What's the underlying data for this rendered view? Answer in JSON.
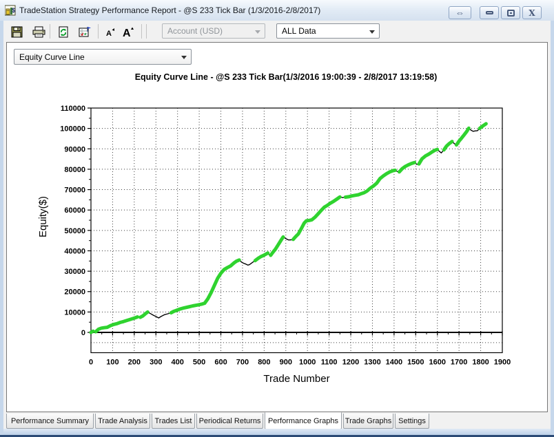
{
  "window": {
    "title": "TradeStation Strategy Performance Report - @S 233 Tick Bar (1/3/2016-2/8/2017)",
    "buttons": {
      "dock": "⇔",
      "close": "X"
    }
  },
  "toolbar": {
    "icons": [
      "save-icon",
      "print-icon",
      "refresh-icon",
      "format-report-icon",
      "font-decrease-icon",
      "font-increase-icon"
    ],
    "account_combo": {
      "value": "Account (USD)",
      "disabled": true
    },
    "data_combo": {
      "value": "ALL Data",
      "disabled": false
    }
  },
  "report": {
    "graph_type_combo": {
      "value": "Equity Curve Line"
    }
  },
  "tabs": {
    "active": "Performance Graphs",
    "items": [
      {
        "label": "Performance Summary"
      },
      {
        "label": "Trade Analysis"
      },
      {
        "label": "Trades List"
      },
      {
        "label": "Periodical Returns"
      },
      {
        "label": "Performance Graphs"
      },
      {
        "label": "Trade Graphs"
      },
      {
        "label": "Settings"
      }
    ]
  },
  "chart_data": {
    "type": "line",
    "title": "Equity Curve Line - @S 233 Tick Bar(1/3/2016 19:00:39 - 2/8/2017 13:19:58)",
    "xlabel": "Trade Number",
    "ylabel": "Equity($)",
    "xlim": [
      0,
      1900
    ],
    "ylim": [
      -10000,
      110000
    ],
    "x_tick_step": 100,
    "y_tick_step": 10000,
    "grid": "dotted",
    "legend": "none",
    "colors": {
      "new_high": "#2fd32f",
      "drawdown": "#000000"
    },
    "coloring_rule": "segment drawn green when equity makes a new running high, black during drawdowns",
    "series": [
      {
        "name": "Equity",
        "points": [
          [
            0,
            0
          ],
          [
            10,
            600
          ],
          [
            22,
            300
          ],
          [
            35,
            1600
          ],
          [
            48,
            2100
          ],
          [
            60,
            2300
          ],
          [
            75,
            2500
          ],
          [
            90,
            3300
          ],
          [
            105,
            3900
          ],
          [
            120,
            4300
          ],
          [
            135,
            4900
          ],
          [
            150,
            5300
          ],
          [
            165,
            5800
          ],
          [
            180,
            6300
          ],
          [
            200,
            7000
          ],
          [
            215,
            7600
          ],
          [
            228,
            7400
          ],
          [
            240,
            8100
          ],
          [
            252,
            9200
          ],
          [
            262,
            10000
          ],
          [
            275,
            9200
          ],
          [
            290,
            8300
          ],
          [
            300,
            7800
          ],
          [
            313,
            7100
          ],
          [
            325,
            7900
          ],
          [
            340,
            8700
          ],
          [
            355,
            9100
          ],
          [
            370,
            9600
          ],
          [
            382,
            10300
          ],
          [
            395,
            10800
          ],
          [
            410,
            11400
          ],
          [
            430,
            12000
          ],
          [
            450,
            12500
          ],
          [
            470,
            13000
          ],
          [
            490,
            13400
          ],
          [
            510,
            13800
          ],
          [
            525,
            14300
          ],
          [
            540,
            16500
          ],
          [
            555,
            19500
          ],
          [
            570,
            23000
          ],
          [
            585,
            26500
          ],
          [
            600,
            29000
          ],
          [
            615,
            30800
          ],
          [
            630,
            31800
          ],
          [
            645,
            32600
          ],
          [
            660,
            34000
          ],
          [
            672,
            34900
          ],
          [
            685,
            35500
          ],
          [
            695,
            34500
          ],
          [
            705,
            33900
          ],
          [
            715,
            33500
          ],
          [
            725,
            33000
          ],
          [
            732,
            33200
          ],
          [
            745,
            34200
          ],
          [
            758,
            35200
          ],
          [
            772,
            36300
          ],
          [
            785,
            37200
          ],
          [
            800,
            37900
          ],
          [
            817,
            38900
          ],
          [
            823,
            38100
          ],
          [
            830,
            37800
          ],
          [
            840,
            39200
          ],
          [
            852,
            40800
          ],
          [
            865,
            43000
          ],
          [
            878,
            45200
          ],
          [
            888,
            46800
          ],
          [
            900,
            46000
          ],
          [
            913,
            45300
          ],
          [
            925,
            45400
          ],
          [
            934,
            45600
          ],
          [
            945,
            46900
          ],
          [
            958,
            48300
          ],
          [
            972,
            51000
          ],
          [
            985,
            53600
          ],
          [
            995,
            54700
          ],
          [
            1008,
            54900
          ],
          [
            1020,
            55200
          ],
          [
            1035,
            56500
          ],
          [
            1050,
            58200
          ],
          [
            1065,
            60000
          ],
          [
            1078,
            61400
          ],
          [
            1092,
            62300
          ],
          [
            1105,
            63300
          ],
          [
            1120,
            64200
          ],
          [
            1135,
            65300
          ],
          [
            1150,
            66400
          ],
          [
            1162,
            66100
          ],
          [
            1175,
            66300
          ],
          [
            1190,
            66500
          ],
          [
            1205,
            66900
          ],
          [
            1220,
            67200
          ],
          [
            1235,
            67500
          ],
          [
            1250,
            68100
          ],
          [
            1262,
            68500
          ],
          [
            1275,
            69300
          ],
          [
            1290,
            70700
          ],
          [
            1305,
            71800
          ],
          [
            1320,
            73200
          ],
          [
            1335,
            75400
          ],
          [
            1350,
            76700
          ],
          [
            1365,
            77800
          ],
          [
            1380,
            78700
          ],
          [
            1395,
            79300
          ],
          [
            1405,
            79500
          ],
          [
            1415,
            78900
          ],
          [
            1424,
            78700
          ],
          [
            1438,
            80300
          ],
          [
            1452,
            81400
          ],
          [
            1465,
            82100
          ],
          [
            1480,
            82800
          ],
          [
            1495,
            83300
          ],
          [
            1505,
            82400
          ],
          [
            1515,
            82600
          ],
          [
            1529,
            85100
          ],
          [
            1545,
            86500
          ],
          [
            1560,
            87400
          ],
          [
            1576,
            88500
          ],
          [
            1590,
            89400
          ],
          [
            1600,
            89700
          ],
          [
            1610,
            88700
          ],
          [
            1618,
            88000
          ],
          [
            1630,
            89500
          ],
          [
            1642,
            91300
          ],
          [
            1655,
            92600
          ],
          [
            1668,
            93600
          ],
          [
            1678,
            92600
          ],
          [
            1688,
            91900
          ],
          [
            1700,
            93800
          ],
          [
            1712,
            95300
          ],
          [
            1724,
            96900
          ],
          [
            1736,
            98600
          ],
          [
            1745,
            100100
          ],
          [
            1755,
            99200
          ],
          [
            1765,
            98600
          ],
          [
            1775,
            98800
          ],
          [
            1785,
            98900
          ],
          [
            1795,
            100000
          ],
          [
            1805,
            100800
          ],
          [
            1815,
            101600
          ],
          [
            1825,
            102300
          ]
        ]
      }
    ]
  }
}
